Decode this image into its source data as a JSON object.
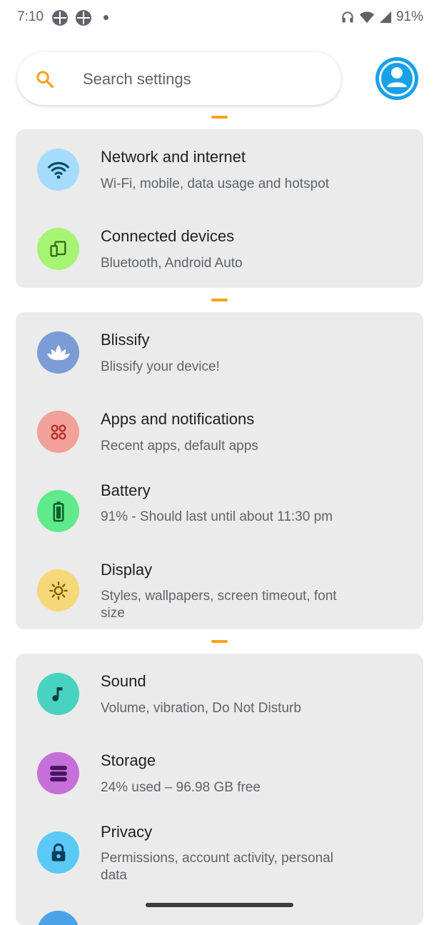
{
  "status_bar": {
    "time": "7:10",
    "battery_percent": "91%",
    "icons": [
      "app-notification-icon",
      "app-notification-icon",
      "more-notifications-dot",
      "headphones-icon",
      "wifi-icon",
      "cellular-signal-icon"
    ]
  },
  "search": {
    "placeholder": "Search settings",
    "icon": "search-icon"
  },
  "profile": {
    "icon": "account-avatar-icon",
    "color": "#18a0e8"
  },
  "groups": [
    {
      "items": [
        {
          "title": "Network and internet",
          "subtitle": "Wi-Fi, mobile, data usage and hotspot",
          "icon": "wifi-icon",
          "color": "#a5dcfb"
        },
        {
          "title": "Connected devices",
          "subtitle": "Bluetooth, Android Auto",
          "icon": "connected-devices-icon",
          "color": "#a6f473"
        }
      ]
    },
    {
      "items": [
        {
          "title": "Blissify",
          "subtitle": "Blissify your device!",
          "icon": "lotus-icon",
          "color": "#7c9cd6"
        },
        {
          "title": "Apps and notifications",
          "subtitle": "Recent apps, default apps",
          "icon": "apps-icon",
          "color": "#f0a199"
        },
        {
          "title": "Battery",
          "subtitle": "91% - Should last until about 11:30 pm",
          "icon": "battery-icon",
          "color": "#61ea8b"
        },
        {
          "title": "Display",
          "subtitle": "Styles, wallpapers, screen timeout, font size",
          "icon": "brightness-icon",
          "color": "#f5d878"
        }
      ]
    },
    {
      "items": [
        {
          "title": "Sound",
          "subtitle": "Volume, vibration, Do Not Disturb",
          "icon": "music-note-icon",
          "color": "#48d3c1"
        },
        {
          "title": "Storage",
          "subtitle": "24% used – 96.98 GB free",
          "icon": "storage-icon",
          "color": "#c56fd9"
        },
        {
          "title": "Privacy",
          "subtitle": "Permissions, account activity, personal data",
          "icon": "lock-icon",
          "color": "#5ac9f5"
        }
      ]
    }
  ],
  "colors": {
    "accent": "#f6a21a",
    "card_bg": "#ebebeb"
  }
}
